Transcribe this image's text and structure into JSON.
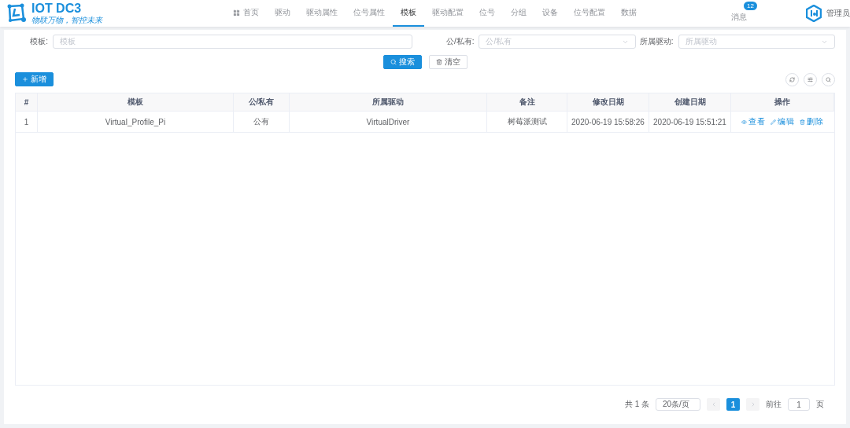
{
  "logo": {
    "title": "IOT DC3",
    "slogan": "物联万物，智控未来"
  },
  "nav": [
    {
      "label": "首页",
      "selected": false,
      "icon": true
    },
    {
      "label": "驱动",
      "selected": false
    },
    {
      "label": "驱动属性",
      "selected": false
    },
    {
      "label": "位号属性",
      "selected": false
    },
    {
      "label": "模板",
      "selected": true
    },
    {
      "label": "驱动配置",
      "selected": false
    },
    {
      "label": "位号",
      "selected": false
    },
    {
      "label": "分组",
      "selected": false
    },
    {
      "label": "设备",
      "selected": false
    },
    {
      "label": "位号配置",
      "selected": false
    },
    {
      "label": "数据",
      "selected": false
    }
  ],
  "messages": {
    "label": "消息",
    "badge": "12"
  },
  "user": {
    "name": "管理员"
  },
  "filters": [
    {
      "kind": "input",
      "label": "模板:",
      "placeholder": "模板"
    },
    {
      "kind": "select",
      "label": "公/私有:",
      "placeholder": "公/私有"
    },
    {
      "kind": "select",
      "label": "所属驱动:",
      "placeholder": "所属驱动"
    }
  ],
  "search_button": "搜索",
  "clear_button": "清空",
  "add_button": "新增",
  "table": {
    "columns": [
      "#",
      "模板",
      "公/私有",
      "所属驱动",
      "备注",
      "修改日期",
      "创建日期",
      "操作"
    ],
    "rows": [
      {
        "cells": [
          "1",
          "Virtual_Profile_Pi",
          "公有",
          "VirtualDriver",
          "树莓派测试",
          "2020-06-19 15:58:26",
          "2020-06-19 15:51:21"
        ],
        "actions": [
          "查看",
          "编辑",
          "删除"
        ]
      }
    ]
  },
  "pagination": {
    "total": "共 1 条",
    "page_size": "20条/页",
    "pages": [
      {
        "label": "1",
        "selected": true
      }
    ],
    "goto_label": "前往",
    "goto_value": "1",
    "goto_suffix": "页"
  }
}
